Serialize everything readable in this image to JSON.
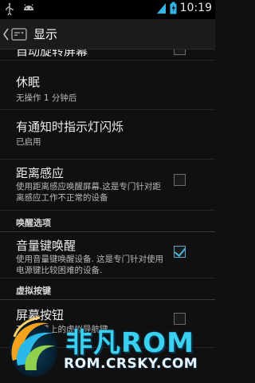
{
  "status_bar": {
    "time": "10:19",
    "icons": [
      "usb-icon",
      "android-debug-icon",
      "signal-icon",
      "battery-icon"
    ]
  },
  "action_bar": {
    "title": "显示",
    "icon": "display-settings-icon"
  },
  "list": {
    "partial_top": {
      "title": "自动旋转屏幕",
      "checked": false
    },
    "items": [
      {
        "title": "休眠",
        "summary": "无操作 1 分钟后"
      },
      {
        "title": "有通知时指示灯闪烁",
        "summary": "已启用"
      },
      {
        "title": "距离感应",
        "summary": "使用距离感应唤醒屏幕.这是专门针对距离感应工作不正常的设备",
        "checked": false
      }
    ],
    "section_wake": "唤醒选项",
    "volume_wake": {
      "title": "音量键唤醒",
      "summary": "使用音量键唤醒设备. 这是专门针对使用电源键比较困难的设备.",
      "checked": true
    },
    "section_virtual": "虚拟按键",
    "screen_buttons": {
      "title": "屏幕按钮",
      "summary": "开启屏幕上的虚拟导航键",
      "checked": false
    }
  },
  "watermark": {
    "brand": "非凡ROM",
    "domain": "ROM.CRSKY.COM"
  },
  "colors": {
    "accent": "#33B5E5",
    "background": "#101010",
    "actionbar": "#1B1B1B"
  }
}
